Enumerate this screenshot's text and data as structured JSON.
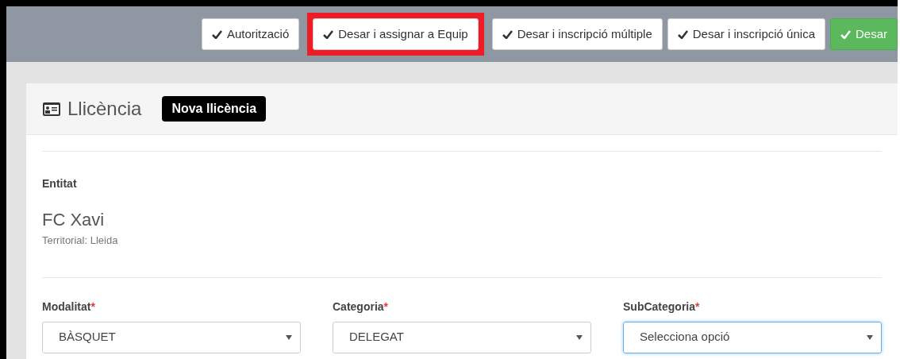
{
  "toolbar": {
    "buttons": [
      {
        "label": "Autorització",
        "kind": "default",
        "highlighted": false
      },
      {
        "label": "Desar i assignar a Equip",
        "kind": "default",
        "highlighted": true
      },
      {
        "label": "Desar i inscripció múltiple",
        "kind": "default",
        "highlighted": false
      },
      {
        "label": "Desar i inscripció única",
        "kind": "default",
        "highlighted": false
      },
      {
        "label": "Desar",
        "kind": "primary",
        "highlighted": false
      }
    ]
  },
  "panel": {
    "title": "Llicència",
    "badge": "Nova llicència",
    "entity": {
      "label": "Entitat",
      "name": "FC Xavi",
      "territory": "Territorial: Lleida"
    },
    "fields": [
      {
        "label": "Modalitat",
        "required_mark": "*",
        "value": "BÀSQUET",
        "focused": false
      },
      {
        "label": "Categoria",
        "required_mark": "*",
        "value": "DELEGAT",
        "focused": false
      },
      {
        "label": "SubCategoria",
        "required_mark": "*",
        "value": "Selecciona opció",
        "focused": true
      }
    ]
  }
}
